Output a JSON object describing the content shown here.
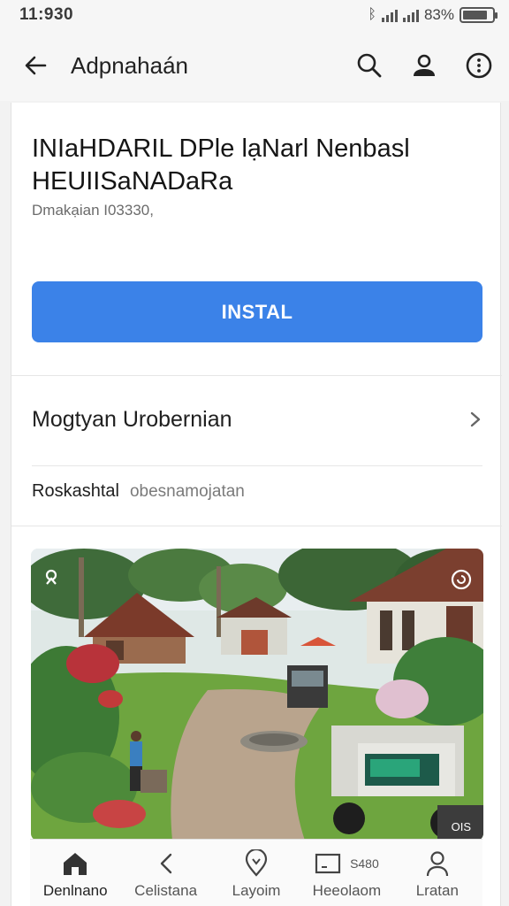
{
  "status_bar": {
    "time": "11:930",
    "battery": "83%",
    "battery_level": 0.83
  },
  "app_bar": {
    "title": "Adpnahaán",
    "icons": [
      "back-arrow-icon",
      "search-icon",
      "account-icon",
      "more-options-icon"
    ]
  },
  "app_card": {
    "name_line1": "INIaHDARIL DPle lạNarl Nenbasl",
    "name_line2": "HEUIISaNADaRa",
    "meta": "Dmakạian I03330,",
    "install_label": "INSTAL",
    "nav_row_label": "Mogtyan Urobernian",
    "info_label": "Roskashtal",
    "info_value": "obesnamojatan",
    "screenshot_corner_label": "OIS"
  },
  "bottom_nav": {
    "items": [
      {
        "label": "Denlnano",
        "icon": "home-icon"
      },
      {
        "label": "Celistana",
        "icon": "chevron-left-icon"
      },
      {
        "label": "Layoim",
        "icon": "map-pin-icon"
      },
      {
        "label": "Heeolaom",
        "icon": "tablet-icon",
        "extra": "S480"
      },
      {
        "label": "Lratan",
        "icon": "person-icon"
      }
    ]
  },
  "colors": {
    "accent": "#3b82e8",
    "background": "#f2f2f2",
    "card": "#ffffff"
  }
}
